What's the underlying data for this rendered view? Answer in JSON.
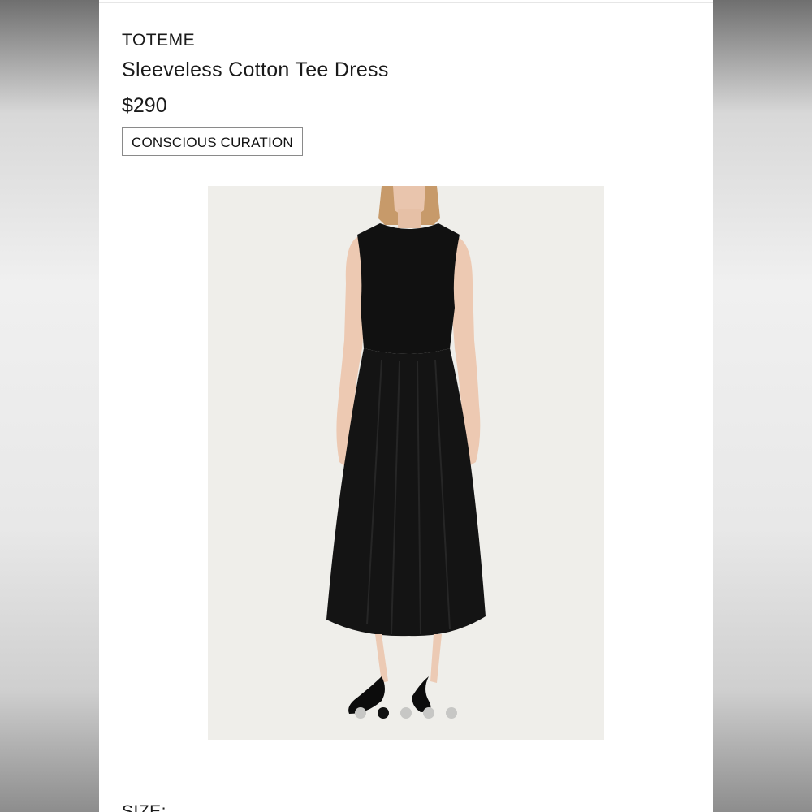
{
  "product": {
    "brand": "TOTEME",
    "name": "Sleeveless Cotton Tee Dress",
    "price": "$290",
    "badge": "CONSCIOUS CURATION"
  },
  "gallery": {
    "image": "product-photo-black-dress",
    "dots": 5,
    "active_index": 1
  },
  "size": {
    "label": "SIZE:"
  },
  "colors": {
    "text": "#1a1a1a",
    "gallery_bg": "#efeeea",
    "dot_active": "#111111",
    "dot_inactive": "#c7c7c5"
  }
}
